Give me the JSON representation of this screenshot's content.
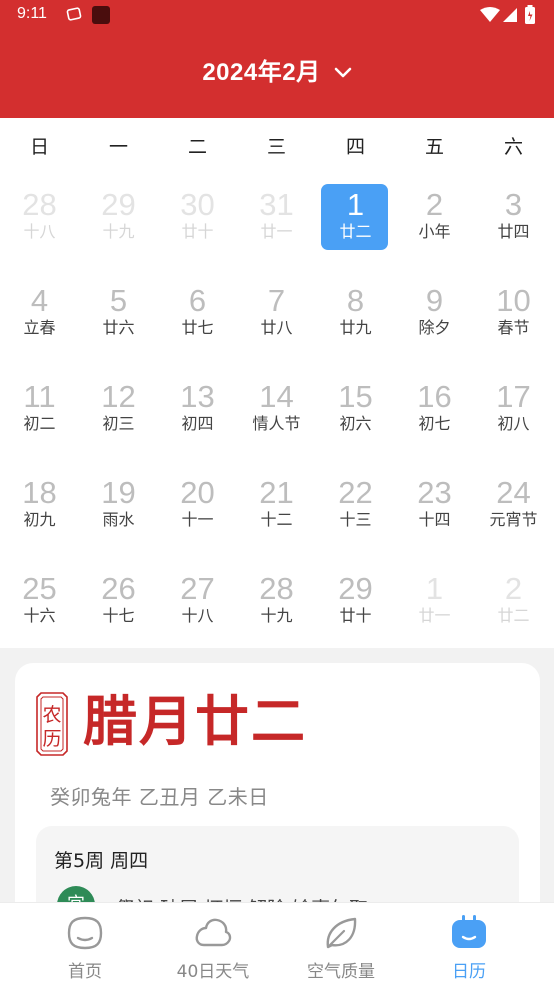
{
  "status_bar": {
    "time": "9:11",
    "icons": [
      "notification-icon",
      "app-icon",
      "wifi-icon",
      "signal-icon",
      "battery-icon"
    ]
  },
  "header": {
    "title": "2024年2月",
    "dropdown_icon": "chevron-down-icon",
    "background": "#d32f2f"
  },
  "calendar": {
    "weekdays": [
      "日",
      "一",
      "二",
      "三",
      "四",
      "五",
      "六"
    ],
    "selected_color": "#4aa0f5",
    "weeks": [
      [
        {
          "d": "28",
          "l": "十八",
          "other": true
        },
        {
          "d": "29",
          "l": "十九",
          "other": true
        },
        {
          "d": "30",
          "l": "廿十",
          "other": true
        },
        {
          "d": "31",
          "l": "廿一",
          "other": true
        },
        {
          "d": "1",
          "l": "廿二",
          "selected": true
        },
        {
          "d": "2",
          "l": "小年"
        },
        {
          "d": "3",
          "l": "廿四"
        }
      ],
      [
        {
          "d": "4",
          "l": "立春"
        },
        {
          "d": "5",
          "l": "廿六"
        },
        {
          "d": "6",
          "l": "廿七"
        },
        {
          "d": "7",
          "l": "廿八"
        },
        {
          "d": "8",
          "l": "廿九"
        },
        {
          "d": "9",
          "l": "除夕"
        },
        {
          "d": "10",
          "l": "春节"
        }
      ],
      [
        {
          "d": "11",
          "l": "初二"
        },
        {
          "d": "12",
          "l": "初三"
        },
        {
          "d": "13",
          "l": "初四"
        },
        {
          "d": "14",
          "l": "情人节"
        },
        {
          "d": "15",
          "l": "初六"
        },
        {
          "d": "16",
          "l": "初七"
        },
        {
          "d": "17",
          "l": "初八"
        }
      ],
      [
        {
          "d": "18",
          "l": "初九"
        },
        {
          "d": "19",
          "l": "雨水"
        },
        {
          "d": "20",
          "l": "十一"
        },
        {
          "d": "21",
          "l": "十二"
        },
        {
          "d": "22",
          "l": "十三"
        },
        {
          "d": "23",
          "l": "十四"
        },
        {
          "d": "24",
          "l": "元宵节"
        }
      ],
      [
        {
          "d": "25",
          "l": "十六"
        },
        {
          "d": "26",
          "l": "十七"
        },
        {
          "d": "27",
          "l": "十八"
        },
        {
          "d": "28",
          "l": "十九"
        },
        {
          "d": "29",
          "l": "廿十"
        },
        {
          "d": "1",
          "l": "廿一",
          "other": true
        },
        {
          "d": "2",
          "l": "廿二",
          "other": true
        }
      ]
    ]
  },
  "detail": {
    "seal_text": [
      "农",
      "历"
    ],
    "lunar_date": "腊月廿二",
    "ganzhi": "癸卯兔年  乙丑月  乙未日",
    "week_info": "第5周  周四",
    "yi_label": "宜",
    "yi_items": "祭祀  破屋  坏垣  解除  馀事勿取"
  },
  "tabs": [
    {
      "label": "首页",
      "icon": "home-face-icon"
    },
    {
      "label": "40日天气",
      "icon": "cloud-icon"
    },
    {
      "label": "空气质量",
      "icon": "leaf-icon"
    },
    {
      "label": "日历",
      "icon": "calendar-icon",
      "active": true
    }
  ]
}
